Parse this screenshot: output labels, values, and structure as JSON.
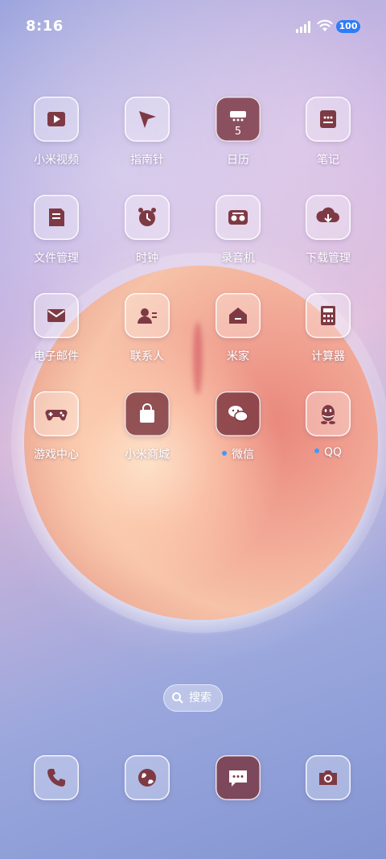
{
  "status_bar": {
    "time": "8:16",
    "battery": "100"
  },
  "apps": [
    {
      "label": "小米视频",
      "icon": "video-play-icon"
    },
    {
      "label": "指南针",
      "icon": "compass-icon"
    },
    {
      "label": "日历",
      "icon": "calendar-icon",
      "badge": "5"
    },
    {
      "label": "笔记",
      "icon": "notes-icon"
    },
    {
      "label": "文件管理",
      "icon": "folder-icon"
    },
    {
      "label": "时钟",
      "icon": "alarm-clock-icon"
    },
    {
      "label": "录音机",
      "icon": "recorder-icon"
    },
    {
      "label": "下载管理",
      "icon": "download-icon"
    },
    {
      "label": "电子邮件",
      "icon": "mail-icon"
    },
    {
      "label": "联系人",
      "icon": "contact-icon"
    },
    {
      "label": "米家",
      "icon": "home-icon"
    },
    {
      "label": "计算器",
      "icon": "calculator-icon"
    },
    {
      "label": "游戏中心",
      "icon": "gamepad-icon"
    },
    {
      "label": "小米商城",
      "icon": "shopping-bag-icon"
    },
    {
      "label": "微信",
      "icon": "wechat-icon",
      "new": true
    },
    {
      "label": "QQ",
      "icon": "qq-penguin-icon",
      "new": true
    }
  ],
  "search": {
    "label": "搜索"
  },
  "dock": [
    {
      "icon": "phone-icon"
    },
    {
      "icon": "browser-globe-icon"
    },
    {
      "icon": "messages-icon"
    },
    {
      "icon": "camera-icon"
    }
  ],
  "colors": {
    "icon_glyph": "#7e3a44",
    "notification_dot": "#3a9bff",
    "battery": "#2f7cf6"
  }
}
